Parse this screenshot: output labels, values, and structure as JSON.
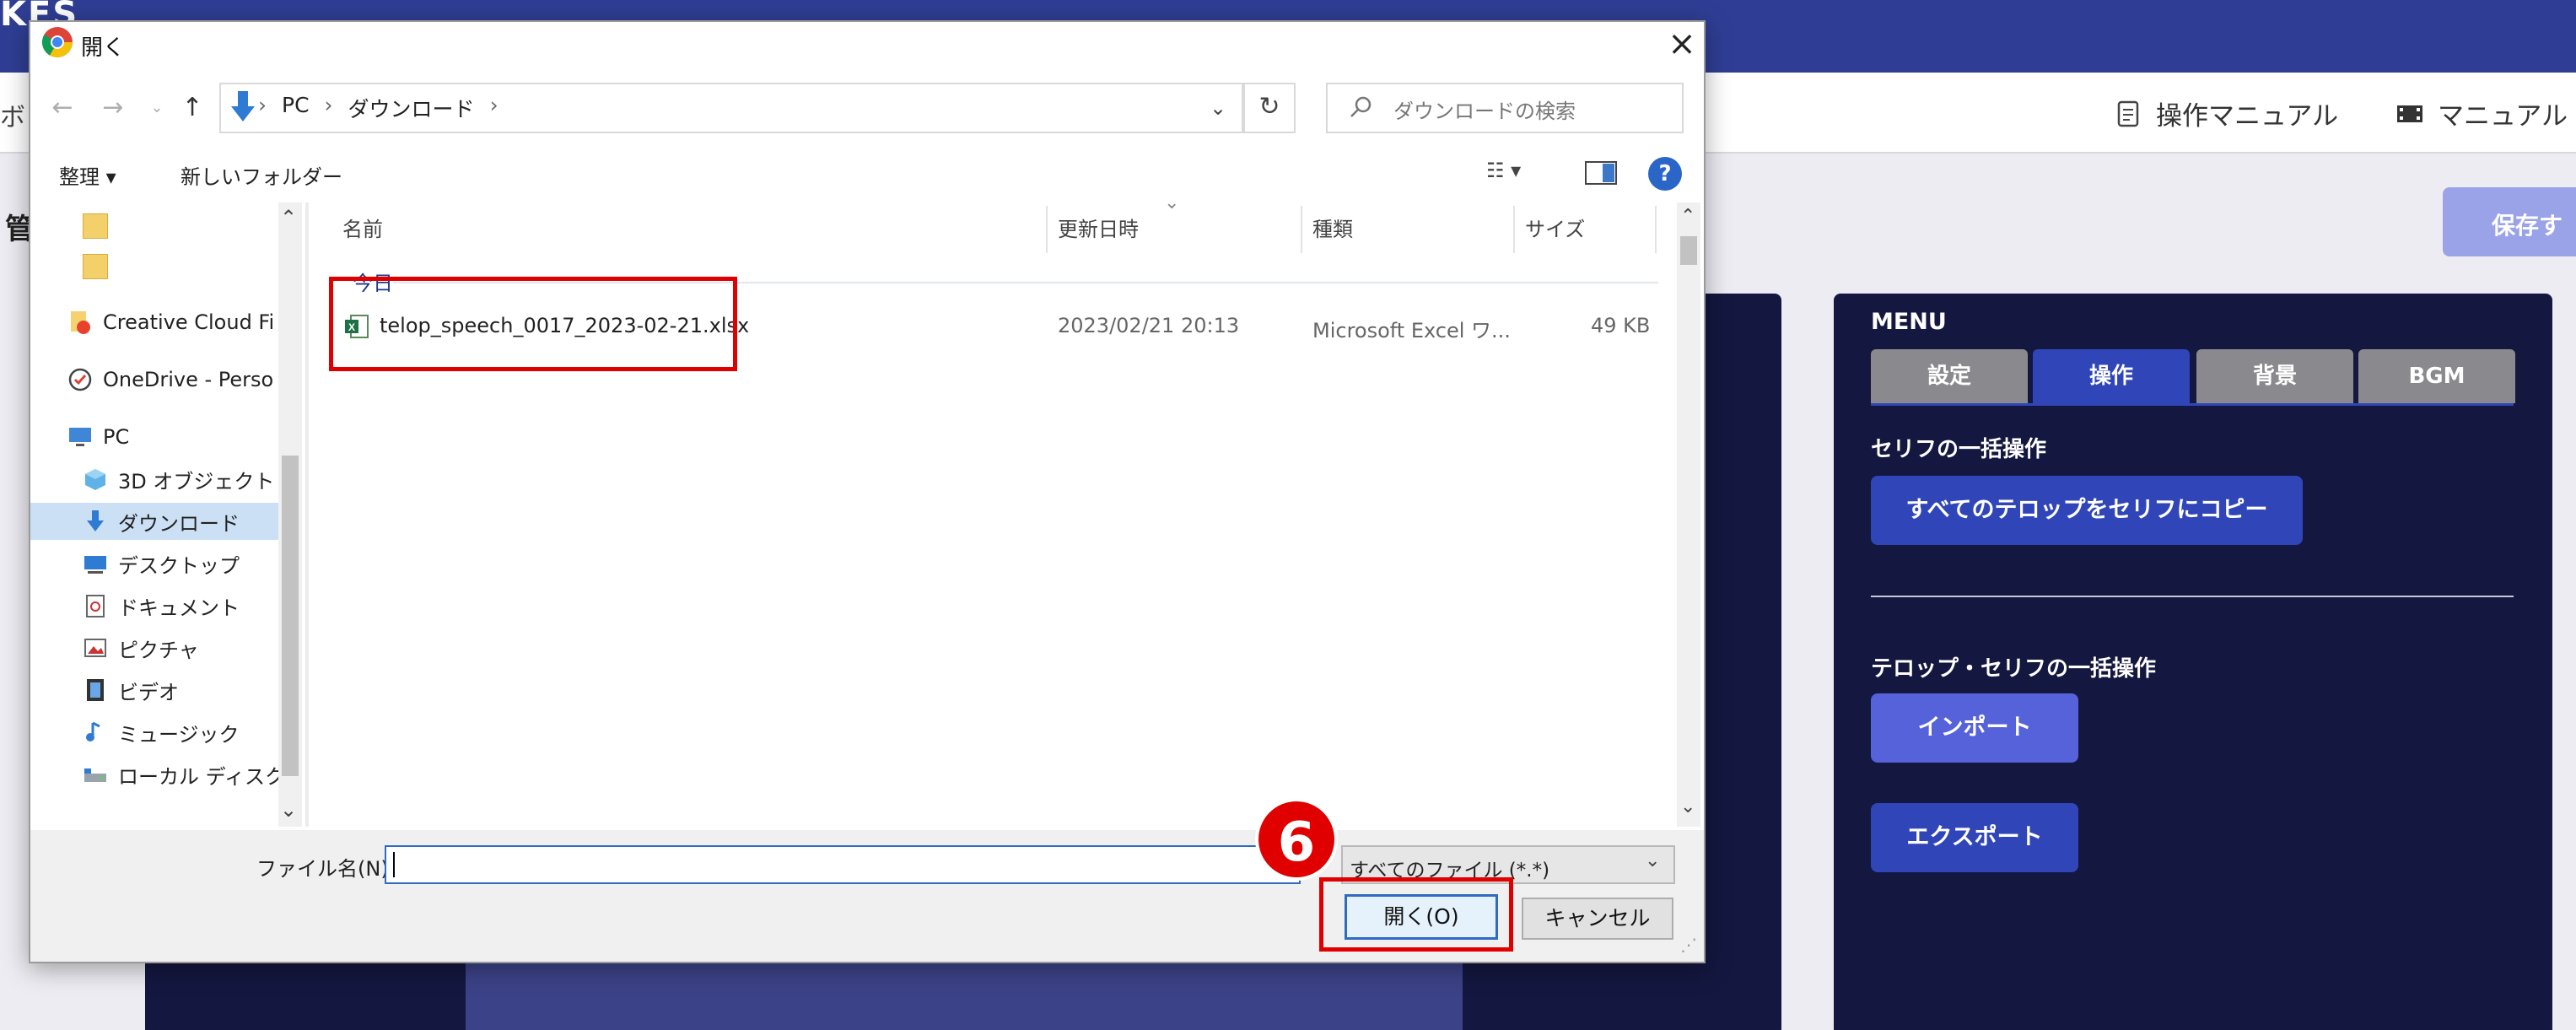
{
  "app": {
    "logo_text": "KES",
    "header_left": "ボ",
    "header_links": [
      {
        "label": "操作マニュアル",
        "icon": "document-icon"
      },
      {
        "label": "マニュアル",
        "icon": "video-icon"
      }
    ],
    "page_title": "管",
    "save_label": "保存す",
    "menu": {
      "title": "MENU",
      "tabs": [
        {
          "label": "設定",
          "active": false
        },
        {
          "label": "操作",
          "active": true
        },
        {
          "label": "背景",
          "active": false
        },
        {
          "label": "BGM",
          "active": false
        }
      ],
      "section1_label": "セリフの一括操作",
      "copy_button": "すべてのテロップをセリフにコピー",
      "section2_label": "テロップ・セリフの一括操作",
      "import_button": "インポート",
      "export_button": "エクスポート"
    }
  },
  "dialog": {
    "title": "開く",
    "close": "×",
    "path": [
      "PC",
      "ダウンロード"
    ],
    "search_placeholder": "ダウンロードの検索",
    "toolbar": {
      "organize": "整理 ▾",
      "new_folder": "新しいフォルダー",
      "help": "?"
    },
    "nav": [
      {
        "label": "",
        "icon": "folder-icon",
        "kind": "child"
      },
      {
        "label": "",
        "icon": "folder-icon",
        "kind": "child"
      },
      {
        "label": "Creative Cloud Files",
        "icon": "creative-cloud-icon",
        "kind": "root"
      },
      {
        "label": "OneDrive - Personal",
        "icon": "onedrive-icon",
        "kind": "root"
      },
      {
        "label": "PC",
        "icon": "pc-icon",
        "kind": "root"
      },
      {
        "label": "3D オブジェクト",
        "icon": "3d-objects-icon",
        "kind": "child"
      },
      {
        "label": "ダウンロード",
        "icon": "download-icon",
        "kind": "selected"
      },
      {
        "label": "デスクトップ",
        "icon": "desktop-icon",
        "kind": "child"
      },
      {
        "label": "ドキュメント",
        "icon": "documents-icon",
        "kind": "child"
      },
      {
        "label": "ピクチャ",
        "icon": "pictures-icon",
        "kind": "child"
      },
      {
        "label": "ビデオ",
        "icon": "videos-icon",
        "kind": "child"
      },
      {
        "label": "ミュージック",
        "icon": "music-icon",
        "kind": "child"
      },
      {
        "label": "ローカル ディスク (C:)",
        "icon": "disk-icon",
        "kind": "child"
      }
    ],
    "columns": [
      "名前",
      "更新日時",
      "種類",
      "サイズ"
    ],
    "group_label": "今日",
    "file": {
      "name": "telop_speech_0017_2023-02-21.xlsx",
      "modified": "2023/02/21 20:13",
      "type": "Microsoft Excel ワ...",
      "size": "49 KB"
    },
    "filename_label": "ファイル名(N):",
    "filename_value": "",
    "filetype": "すべてのファイル (*.*)",
    "open_button": "開く(O)",
    "cancel_button": "キャンセル",
    "step_number": "6"
  },
  "colors": {
    "highlight": "#e00000",
    "app_navy": "#14173f",
    "accent": "#3046b8"
  }
}
